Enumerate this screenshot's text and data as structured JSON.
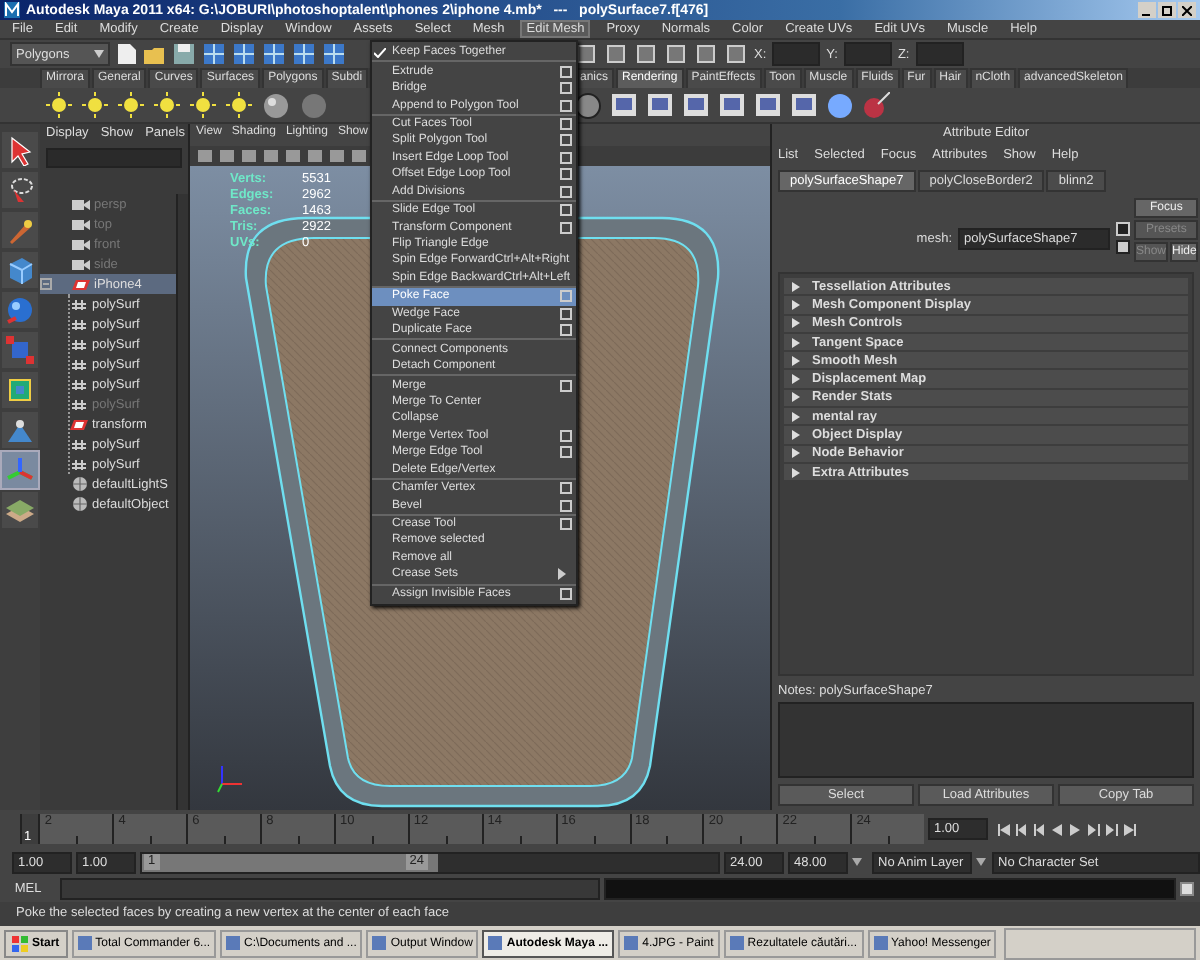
{
  "window": {
    "title": "Autodesk Maya 2011 x64: G:\\JOBURI\\photoshoptalent\\phones 2\\iphone 4.mb*   ---   polySurface7.f[476]"
  },
  "menubar": [
    {
      "label": "File",
      "selected": false
    },
    {
      "label": "Edit",
      "selected": false
    },
    {
      "label": "Modify",
      "selected": false
    },
    {
      "label": "Create",
      "selected": false
    },
    {
      "label": "Display",
      "selected": false
    },
    {
      "label": "Window",
      "selected": false
    },
    {
      "label": "Assets",
      "selected": false
    },
    {
      "label": "Select",
      "selected": false
    },
    {
      "label": "Mesh",
      "selected": false
    },
    {
      "label": "Edit Mesh",
      "selected": true
    },
    {
      "label": "Proxy",
      "selected": false
    },
    {
      "label": "Normals",
      "selected": false
    },
    {
      "label": "Color",
      "selected": false
    },
    {
      "label": "Create UVs",
      "selected": false
    },
    {
      "label": "Edit UVs",
      "selected": false
    },
    {
      "label": "Muscle",
      "selected": false
    },
    {
      "label": "Help",
      "selected": false
    }
  ],
  "status_line": {
    "mode": "Polygons",
    "fields": [
      "X:",
      "Y:",
      "Z:"
    ]
  },
  "shelf": {
    "tabs_left": [
      {
        "label": "Mirrora",
        "selected": false
      },
      {
        "label": "General",
        "selected": false
      },
      {
        "label": "Curves",
        "selected": false
      },
      {
        "label": "Surfaces",
        "selected": false
      },
      {
        "label": "Polygons",
        "selected": false
      },
      {
        "label": "Subdi",
        "selected": false
      }
    ],
    "tabs_right": [
      {
        "label": "anics",
        "selected": false
      },
      {
        "label": "Rendering",
        "selected": true
      },
      {
        "label": "PaintEffects",
        "selected": false
      },
      {
        "label": "Toon",
        "selected": false
      },
      {
        "label": "Muscle",
        "selected": false
      },
      {
        "label": "Fluids",
        "selected": false
      },
      {
        "label": "Fur",
        "selected": false
      },
      {
        "label": "Hair",
        "selected": false
      },
      {
        "label": "nCloth",
        "selected": false
      },
      {
        "label": "advancedSkeleton",
        "selected": false
      }
    ]
  },
  "toolbox": [
    {
      "selected": false
    },
    {
      "selected": false
    },
    {
      "selected": false
    },
    {
      "selected": false
    },
    {
      "selected": false
    },
    {
      "selected": false
    },
    {
      "selected": false
    },
    {
      "selected": false
    },
    {
      "selected": true
    },
    {
      "selected": false
    }
  ],
  "outliner": {
    "menu": [
      "Display",
      "Show",
      "Panels"
    ],
    "items": [
      {
        "label": "persp",
        "kind": "camera",
        "dimmed": true,
        "selected": false,
        "expanded": false
      },
      {
        "label": "top",
        "kind": "camera",
        "dimmed": true,
        "selected": false,
        "expanded": false
      },
      {
        "label": "front",
        "kind": "camera",
        "dimmed": true,
        "selected": false,
        "expanded": false
      },
      {
        "label": "side",
        "kind": "camera",
        "dimmed": true,
        "selected": false,
        "expanded": false
      },
      {
        "label": "iPhone4",
        "kind": "group",
        "dimmed": false,
        "selected": true,
        "expanded": true,
        "children": [
          {
            "label": "polySurf",
            "kind": "mesh",
            "dimmed": false,
            "selected": false
          },
          {
            "label": "polySurf",
            "kind": "mesh",
            "dimmed": false,
            "selected": false
          },
          {
            "label": "polySurf",
            "kind": "mesh",
            "dimmed": false,
            "selected": false
          },
          {
            "label": "polySurf",
            "kind": "mesh",
            "dimmed": false,
            "selected": false
          },
          {
            "label": "polySurf",
            "kind": "mesh",
            "dimmed": false,
            "selected": false
          },
          {
            "label": "polySurf",
            "kind": "mesh",
            "dimmed": true,
            "selected": false
          },
          {
            "label": "transform",
            "kind": "group",
            "dimmed": false,
            "selected": false
          },
          {
            "label": "polySurf",
            "kind": "mesh",
            "dimmed": false,
            "selected": false
          },
          {
            "label": "polySurf",
            "kind": "mesh",
            "dimmed": false,
            "selected": false
          }
        ]
      },
      {
        "label": "defaultLightS",
        "kind": "set",
        "dimmed": false,
        "selected": false,
        "expanded": false
      },
      {
        "label": "defaultObject",
        "kind": "set",
        "dimmed": false,
        "selected": false,
        "expanded": false
      }
    ]
  },
  "viewport": {
    "menu": [
      "View",
      "Shading",
      "Lighting",
      "Show"
    ],
    "hud": [
      {
        "label": "Verts:",
        "value": "5531"
      },
      {
        "label": "Edges:",
        "value": "2962"
      },
      {
        "label": "Faces:",
        "value": "1463"
      },
      {
        "label": "Tris:",
        "value": "2922"
      },
      {
        "label": "UVs:",
        "value": "0"
      }
    ]
  },
  "edit_mesh_menu": {
    "groups": [
      {
        "items": [
          {
            "label": "Keep Faces Together",
            "kind": "check",
            "checked": true,
            "selected": false
          }
        ]
      },
      {
        "items": [
          {
            "label": "Extrude",
            "kind": "option",
            "selected": false
          },
          {
            "label": "Bridge",
            "kind": "option",
            "selected": false
          },
          {
            "label": "Append to Polygon Tool",
            "kind": "option",
            "selected": false
          }
        ]
      },
      {
        "items": [
          {
            "label": "Cut Faces Tool",
            "kind": "option",
            "selected": false
          },
          {
            "label": "Split Polygon Tool",
            "kind": "option",
            "selected": false
          },
          {
            "label": "Insert Edge Loop Tool",
            "kind": "option",
            "selected": false
          },
          {
            "label": "Offset Edge Loop Tool",
            "kind": "option",
            "selected": false
          },
          {
            "label": "Add Divisions",
            "kind": "option",
            "selected": false
          }
        ]
      },
      {
        "items": [
          {
            "label": "Slide Edge Tool",
            "kind": "option",
            "selected": false
          },
          {
            "label": "Transform Component",
            "kind": "option",
            "selected": false
          },
          {
            "label": "Flip Triangle Edge",
            "kind": "command",
            "selected": false
          },
          {
            "label": "Spin Edge Forward",
            "shortcut": "Ctrl+Alt+Right",
            "kind": "command",
            "selected": false
          },
          {
            "label": "Spin Edge Backward",
            "shortcut": "Ctrl+Alt+Left",
            "kind": "command",
            "selected": false
          }
        ]
      },
      {
        "items": [
          {
            "label": "Poke Face",
            "kind": "option",
            "selected": true
          },
          {
            "label": "Wedge Face",
            "kind": "option",
            "selected": false
          },
          {
            "label": "Duplicate Face",
            "kind": "option",
            "selected": false
          }
        ]
      },
      {
        "items": [
          {
            "label": "Connect Components",
            "kind": "command",
            "selected": false
          },
          {
            "label": "Detach Component",
            "kind": "command",
            "selected": false
          }
        ]
      },
      {
        "items": [
          {
            "label": "Merge",
            "kind": "option",
            "selected": false
          },
          {
            "label": "Merge To Center",
            "kind": "command",
            "selected": false
          },
          {
            "label": "Collapse",
            "kind": "command",
            "selected": false
          },
          {
            "label": "Merge Vertex Tool",
            "kind": "option",
            "selected": false
          },
          {
            "label": "Merge Edge Tool",
            "kind": "option",
            "selected": false
          },
          {
            "label": "Delete Edge/Vertex",
            "kind": "command",
            "selected": false
          }
        ]
      },
      {
        "items": [
          {
            "label": "Chamfer Vertex",
            "kind": "option",
            "selected": false
          },
          {
            "label": "Bevel",
            "kind": "option",
            "selected": false
          }
        ]
      },
      {
        "items": [
          {
            "label": "Crease Tool",
            "kind": "option",
            "selected": false
          },
          {
            "label": "Remove selected",
            "kind": "command",
            "selected": false
          },
          {
            "label": "Remove all",
            "kind": "command",
            "selected": false
          },
          {
            "label": "Crease Sets",
            "kind": "submenu",
            "selected": false
          }
        ]
      },
      {
        "items": [
          {
            "label": "Assign Invisible Faces",
            "kind": "option",
            "selected": false
          }
        ]
      }
    ]
  },
  "attribute_editor": {
    "title": "Attribute Editor",
    "menu": [
      "List",
      "Selected",
      "Focus",
      "Attributes",
      "Show",
      "Help"
    ],
    "tabs": [
      {
        "label": "polySurfaceShape7",
        "selected": true
      },
      {
        "label": "polyCloseBorder2",
        "selected": false
      },
      {
        "label": "blinn2",
        "selected": false
      }
    ],
    "node_label": "mesh:",
    "node_value": "polySurfaceShape7",
    "buttons": [
      {
        "label": "Focus",
        "disabled": false
      },
      {
        "label": "Presets",
        "disabled": true
      },
      {
        "label": "Show",
        "disabled": true
      },
      {
        "label": "Hide",
        "disabled": false
      }
    ],
    "sections": [
      "Tessellation Attributes",
      "Mesh Component Display",
      "Mesh Controls",
      "Tangent Space",
      "Smooth Mesh",
      "Displacement Map",
      "Render Stats",
      "mental ray",
      "Object Display",
      "Node Behavior",
      "Extra Attributes"
    ],
    "notes_label": "Notes:  polySurfaceShape7",
    "actions": [
      "Select",
      "Load Attributes",
      "Copy Tab"
    ]
  },
  "time_slider": {
    "current_frame": "1",
    "level": 0,
    "labels": [
      "2",
      "4",
      "6",
      "8",
      "10",
      "12",
      "14",
      "16",
      "18",
      "20",
      "22",
      "24"
    ],
    "current_time": "1.00"
  },
  "range_slider": {
    "level": 0.5,
    "start": "1.00",
    "playback_start": "1.00",
    "range_start": "1",
    "range_end": "24",
    "playback_end": "24.00",
    "end": "48.00",
    "anim_layer": "No Anim Layer",
    "character_set": "No Character Set"
  },
  "command_line": {
    "label": "MEL"
  },
  "help_line": "Poke the selected faces by creating a new vertex at the center of each face",
  "taskbar": {
    "start": "Start",
    "items": [
      {
        "label": "Total Commander 6...",
        "selected": false
      },
      {
        "label": "C:\\Documents and ...",
        "selected": false
      },
      {
        "label": "Output Window",
        "selected": false
      },
      {
        "label": "Autodesk Maya ...",
        "selected": true
      },
      {
        "label": "4.JPG - Paint",
        "selected": false
      },
      {
        "label": "Rezultatele căutări...",
        "selected": false
      },
      {
        "label": "Yahoo! Messenger",
        "selected": false
      }
    ]
  }
}
